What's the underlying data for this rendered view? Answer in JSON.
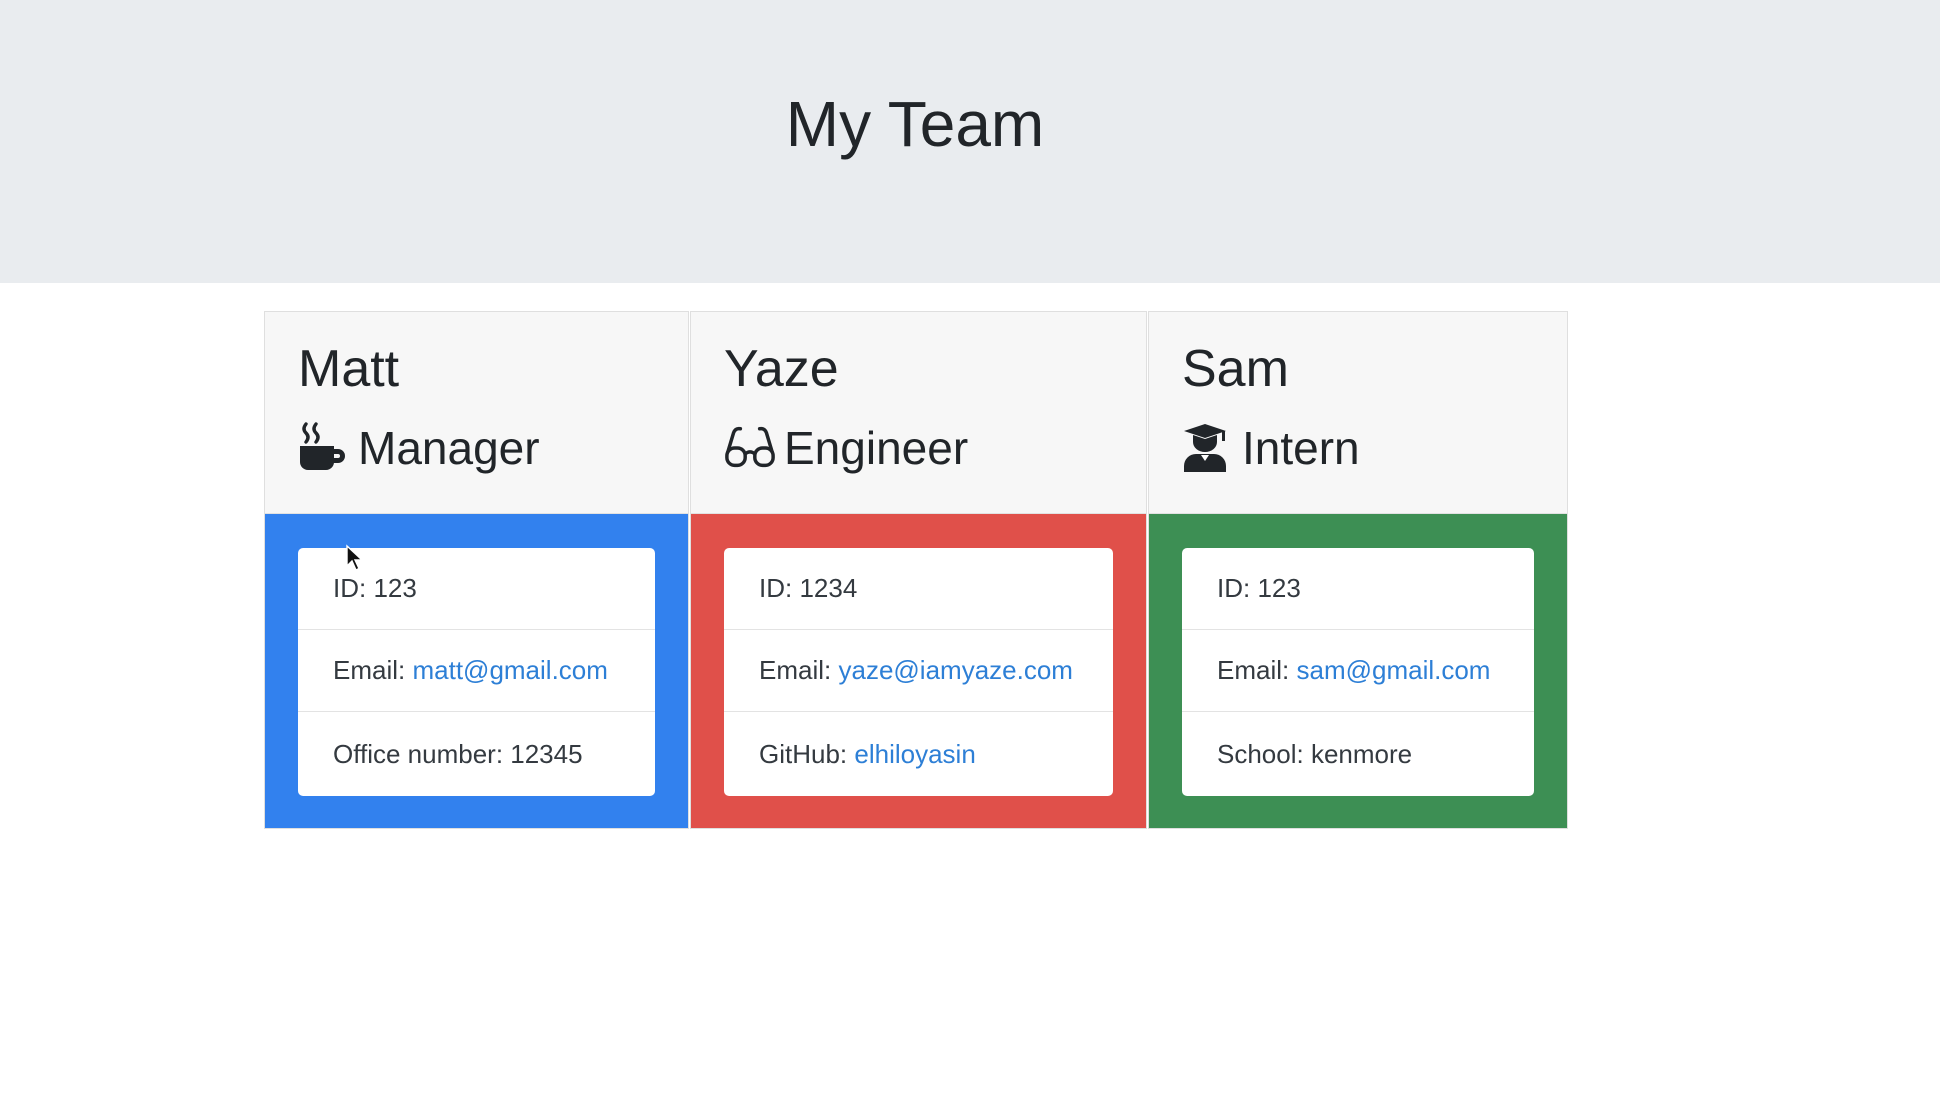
{
  "header": {
    "title": "My Team"
  },
  "colors": {
    "manager_body": "#3281ee",
    "engineer_body": "#e0504a",
    "intern_body": "#3d8f54"
  },
  "employees": [
    {
      "name": "Matt",
      "role": "Manager",
      "icon": "coffee-mug-icon",
      "id_text": "ID: 123",
      "email_label": "Email: ",
      "email": "matt@gmail.com",
      "extra_label": "Office number: 12345",
      "extra_link": ""
    },
    {
      "name": "Yaze",
      "role": "Engineer",
      "icon": "glasses-icon",
      "id_text": "ID: 1234",
      "email_label": "Email: ",
      "email": "yaze@iamyaze.com",
      "extra_label": "GitHub: ",
      "extra_link": "elhiloyasin"
    },
    {
      "name": "Sam",
      "role": "Intern",
      "icon": "graduate-icon",
      "id_text": "ID: 123",
      "email_label": "Email: ",
      "email": "sam@gmail.com",
      "extra_label": "School: kenmore",
      "extra_link": ""
    }
  ]
}
